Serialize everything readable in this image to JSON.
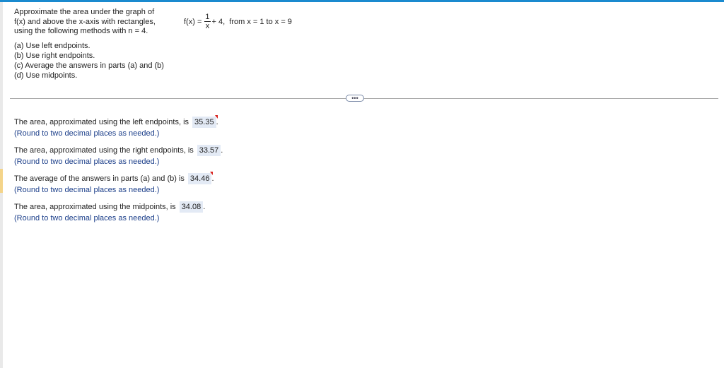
{
  "question": {
    "intro_lines": [
      "Approximate the area under the graph of",
      "f(x) and above the x-axis with rectangles,",
      "using the following methods with n = 4."
    ],
    "parts": [
      "(a) Use left endpoints.",
      "(b) Use right endpoints.",
      "(c) Average the answers in parts (a) and (b)",
      "(d) Use midpoints."
    ]
  },
  "formula": {
    "lhs": "f(x) =",
    "numerator": "1",
    "denominator": "x",
    "rhs": "+ 4,  from x = 1 to x = 9"
  },
  "more_button": {
    "label": "•••"
  },
  "answers": [
    {
      "text": "The area, approximated using the left endpoints, is",
      "value": "35.35",
      "punct": ".",
      "flag": true,
      "hint": "(Round to two decimal places as needed.)"
    },
    {
      "text": "The area, approximated using the right endpoints, is",
      "value": "33.57",
      "punct": ".",
      "flag": false,
      "hint": "(Round to two decimal places as needed.)"
    },
    {
      "text": "The average of the answers in parts (a) and (b) is",
      "value": "34.46",
      "punct": ".",
      "flag": true,
      "hint": "(Round to two decimal places as needed.)"
    },
    {
      "text": "The area, approximated using the midpoints, is",
      "value": "34.08",
      "punct": ".",
      "flag": false,
      "hint": "(Round to two decimal places as needed.)"
    }
  ],
  "colors": {
    "top_rule": "#1a8acf",
    "answer_box": "#e3eaf5",
    "hint_text": "#1c3f8a",
    "incorrect_flag": "#d8201c"
  }
}
